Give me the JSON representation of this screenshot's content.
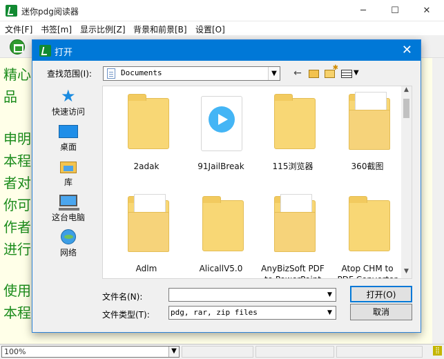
{
  "app": {
    "title": "迷你pdg阅读器",
    "minimize": "─",
    "maximize": "☐",
    "close": "✕"
  },
  "menu": [
    "文件[F]",
    "书签[m]",
    "显示比例[Z]",
    "背景和前景[B]",
    "设置[O]"
  ],
  "reader_lines": [
    "精心",
    "品",
    "",
    "申明",
    "本程",
    "者对",
    "你可",
    "作者",
    "进行",
    "",
    "使用",
    "本程"
  ],
  "status": {
    "zoom": "100%",
    "zoom_arrow": "▼",
    "grip": "⣿"
  },
  "dialog": {
    "title": "打开",
    "close": "✕",
    "look_in_label": "查找范围(I):",
    "look_in_value": "Documents",
    "combo_arrow": "▼",
    "back": "←",
    "places": [
      {
        "label": "快速访问",
        "icon": "star-icon"
      },
      {
        "label": "桌面",
        "icon": "desktop-icon"
      },
      {
        "label": "库",
        "icon": "library-icon"
      },
      {
        "label": "这台电脑",
        "icon": "computer-icon"
      },
      {
        "label": "网络",
        "icon": "network-icon"
      }
    ],
    "files": [
      {
        "name": "2adak",
        "type": "folder"
      },
      {
        "name": "91JailBreak",
        "type": "video-file"
      },
      {
        "name": "115浏览器",
        "type": "folder-with-document"
      },
      {
        "name": "360截图",
        "type": "folder-with-document"
      },
      {
        "name": "Adlm",
        "type": "folder-with-document"
      },
      {
        "name": "AlicallV5.0",
        "type": "folder"
      },
      {
        "name": "AnyBizSoft PDF to PowerPoint",
        "type": "folder-with-document"
      },
      {
        "name": "Atop CHM to PDF Converter",
        "type": "folder"
      }
    ],
    "file_name_label": "文件名(N):",
    "file_name_value": "",
    "file_type_label": "文件类型(T):",
    "file_type_value": "pdg, rar, zip files",
    "open_label": "打开(O)",
    "cancel_label": "取消",
    "scroll_up": "▲",
    "scroll_down": "▼"
  }
}
